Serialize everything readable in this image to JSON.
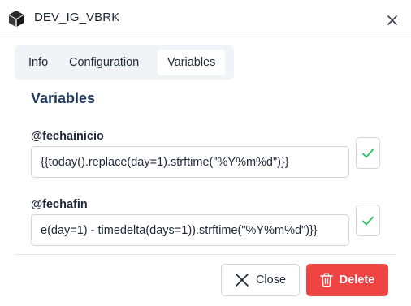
{
  "dialog": {
    "title": "DEV_IG_VBRK",
    "icon": "cube-icon",
    "close_icon": "close-icon"
  },
  "tabs": [
    {
      "label": "Info",
      "active": false
    },
    {
      "label": "Configuration",
      "active": false
    },
    {
      "label": "Variables",
      "active": true
    }
  ],
  "section": {
    "title": "Variables"
  },
  "variables": [
    {
      "name": "@fechainicio",
      "value": "{{today().replace(day=1).strftime(\"%Y%m%d\")}}"
    },
    {
      "name": "@fechafin",
      "value": "e(day=1) - timedelta(days=1)).strftime(\"%Y%m%d\")}}"
    }
  ],
  "footer": {
    "close_label": "Close",
    "delete_label": "Delete"
  },
  "colors": {
    "accent_green": "#22c55e",
    "danger": "#ef4444",
    "title": "#1e3a5f"
  }
}
